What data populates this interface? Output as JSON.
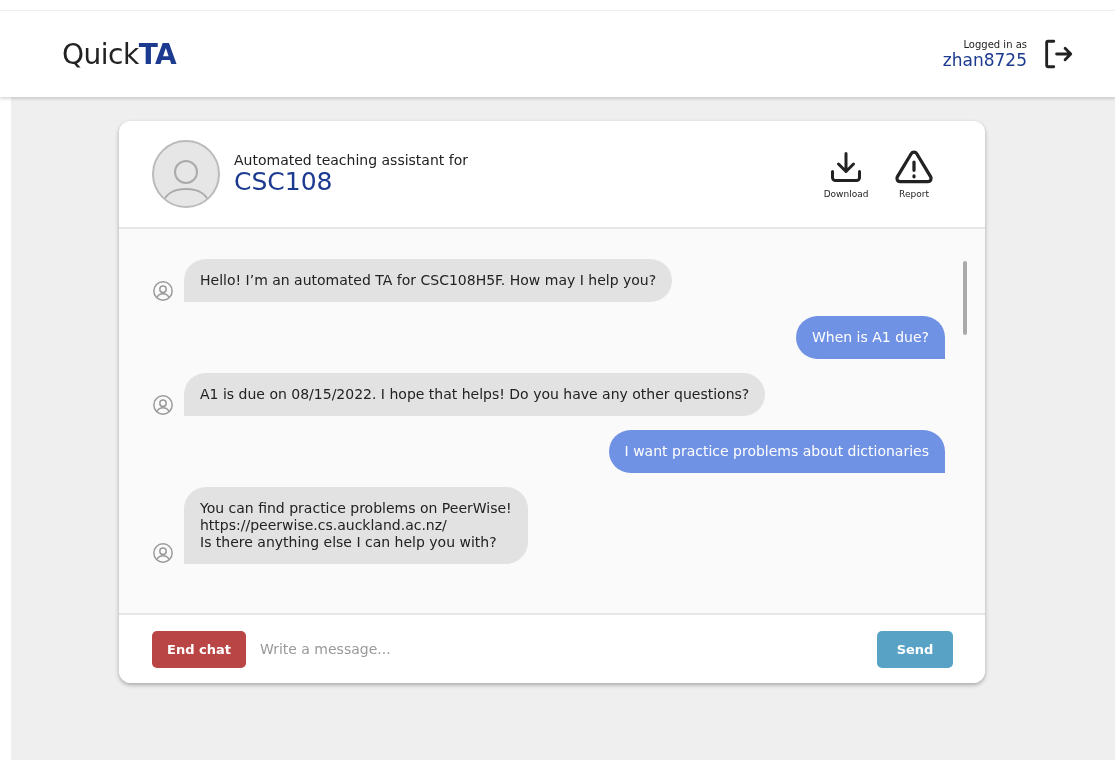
{
  "app": {
    "logo_prefix": "Quick",
    "logo_bold": "TA",
    "login_label": "Logged in as",
    "username": "zhan8725"
  },
  "chat_header": {
    "subtitle": "Automated teaching assistant for",
    "course": "CSC108",
    "actions": [
      {
        "kind": "download",
        "label": "Download"
      },
      {
        "kind": "report",
        "label": "Report"
      }
    ]
  },
  "messages": [
    {
      "kind": "bot",
      "lines": [
        "Hello! I’m an automated TA for CSC108H5F. How may I help you?"
      ]
    },
    {
      "kind": "user",
      "lines": [
        "When is A1 due?"
      ]
    },
    {
      "kind": "bot",
      "lines": [
        "A1 is due on 08/15/2022. I hope that helps! Do you have any other questions?"
      ]
    },
    {
      "kind": "user",
      "lines": [
        "I want practice problems about dictionaries"
      ]
    },
    {
      "kind": "bot",
      "lines": [
        "You can find practice problems on PeerWise!",
        "https://peerwise.cs.auckland.ac.nz/",
        "Is there anything else I can help you with?"
      ]
    }
  ],
  "composer": {
    "end_button": "End chat",
    "placeholder": "Write a message...",
    "send_button": "Send"
  }
}
